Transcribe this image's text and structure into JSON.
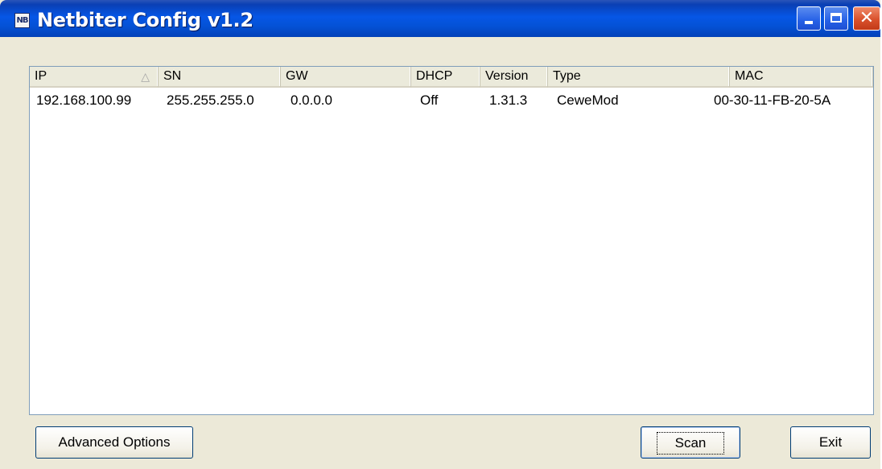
{
  "window": {
    "title": "Netbiter Config v1.2",
    "app_icon_text": "NB",
    "controls": {
      "minimize": "minimize",
      "maximize": "maximize",
      "close": "✕"
    }
  },
  "table": {
    "columns": [
      "IP",
      "SN",
      "GW",
      "DHCP",
      "Version",
      "Type",
      "MAC"
    ],
    "sort_indicator": "△",
    "rows": [
      [
        "192.168.100.99",
        "255.255.255.0",
        "0.0.0.0",
        "Off",
        "1.31.3",
        "CeweMod",
        "00-30-11-FB-20-5A"
      ]
    ]
  },
  "buttons": {
    "advanced_options": "Advanced Options",
    "scan": "Scan",
    "exit": "Exit"
  },
  "colors": {
    "titlebar": "#0452d6",
    "face": "#ece9d8",
    "close": "#d9512c"
  }
}
